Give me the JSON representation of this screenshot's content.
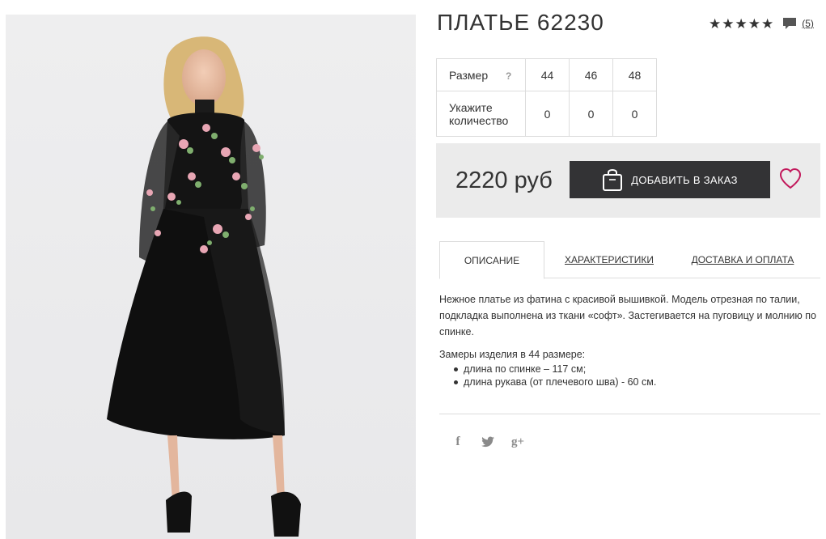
{
  "product": {
    "title": "ПЛАТЬЕ 62230",
    "rating_stars": "★★★★★",
    "review_count": "(5)",
    "price": "2220 руб"
  },
  "sizes": {
    "size_label": "Размер",
    "help_label": "?",
    "quantity_label_line1": "Укажите",
    "quantity_label_line2": "количество",
    "columns": [
      {
        "size": "44",
        "qty": "0"
      },
      {
        "size": "46",
        "qty": "0"
      },
      {
        "size": "48",
        "qty": "0"
      }
    ]
  },
  "cart": {
    "add_button_label": "ДОБАВИТЬ В ЗАКАЗ"
  },
  "tabs": [
    {
      "label": "ОПИСАНИЕ",
      "active": true
    },
    {
      "label": "ХАРАКТЕРИСТИКИ",
      "active": false
    },
    {
      "label": "ДОСТАВКА И ОПЛАТА",
      "active": false
    }
  ],
  "description": {
    "text": "Нежное платье из фатина с красивой вышивкой. Модель отрезная по талии, подкладка выполнена из ткани «софт». Застегивается на пуговицу и молнию по спинке.",
    "measure_title": "Замеры изделия в 44 размере:",
    "measures": [
      "длина по спинке – 117 см;",
      "длина рукава (от плечевого шва) - 60 см."
    ]
  },
  "social": {
    "icons": [
      "facebook-icon",
      "twitter-icon",
      "google-plus-icon"
    ],
    "facebook_glyph": "f",
    "google_glyph": "g+"
  },
  "colors": {
    "accent_heart": "#c2185b",
    "button_bg": "#333335",
    "buybox_bg": "#ebebeb"
  }
}
